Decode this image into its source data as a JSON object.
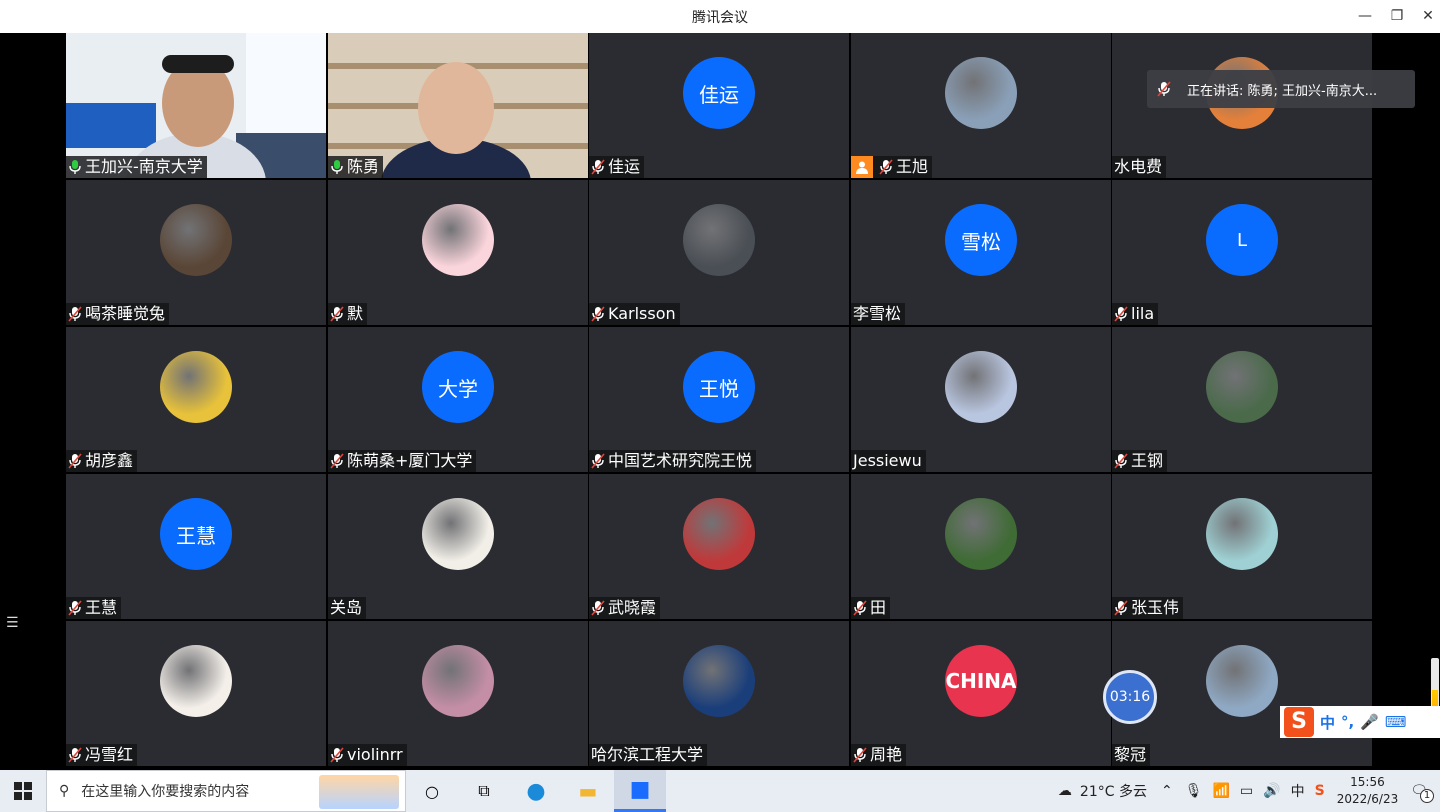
{
  "window": {
    "title": "腾讯会议"
  },
  "speaking_banner": "正在讲话: 陈勇; 王加兴-南京大...",
  "timer": "03:16",
  "participants": [
    {
      "name": "王加兴-南京大学",
      "mic": "on",
      "kind": "video",
      "scene": "office"
    },
    {
      "name": "陈勇",
      "mic": "on",
      "kind": "video",
      "scene": "shelf",
      "speaking": true
    },
    {
      "name": "佳运",
      "mic": "muted",
      "kind": "initials",
      "initials": "佳运"
    },
    {
      "name": "王旭",
      "mic": "muted",
      "kind": "photo",
      "color": "#8aa0b8",
      "host": true
    },
    {
      "name": "水电费",
      "mic": "none",
      "kind": "photo",
      "color": "#e4803a"
    },
    {
      "name": "喝茶睡觉兔",
      "mic": "muted",
      "kind": "photo",
      "color": "#5a4636"
    },
    {
      "name": "默",
      "mic": "muted",
      "kind": "photo",
      "color": "#fbd5dc"
    },
    {
      "name": "Karlsson",
      "mic": "muted",
      "kind": "photo",
      "color": "#4a4f55"
    },
    {
      "name": "李雪松",
      "mic": "none",
      "kind": "initials",
      "initials": "雪松"
    },
    {
      "name": "lila",
      "mic": "muted",
      "kind": "initials",
      "initials": "L"
    },
    {
      "name": "胡彦鑫",
      "mic": "muted",
      "kind": "photo",
      "color": "#e8c23a"
    },
    {
      "name": "陈萌桑+厦门大学",
      "mic": "muted",
      "kind": "initials",
      "initials": "大学"
    },
    {
      "name": "中国艺术研究院王悦",
      "mic": "muted",
      "kind": "initials",
      "initials": "王悦"
    },
    {
      "name": "Jessiewu",
      "mic": "none",
      "kind": "photo",
      "color": "#b9c6e0"
    },
    {
      "name": "王钢",
      "mic": "muted",
      "kind": "photo",
      "color": "#4a6a4a"
    },
    {
      "name": "王慧",
      "mic": "muted",
      "kind": "initials",
      "initials": "王慧"
    },
    {
      "name": "关岛",
      "mic": "none",
      "kind": "photo",
      "color": "#f2efe8"
    },
    {
      "name": "武晓霞",
      "mic": "muted",
      "kind": "photo",
      "color": "#c0393a"
    },
    {
      "name": "田",
      "mic": "muted",
      "kind": "photo",
      "color": "#3f6b35"
    },
    {
      "name": "张玉伟",
      "mic": "muted",
      "kind": "photo",
      "color": "#9fd1d4"
    },
    {
      "name": "冯雪红",
      "mic": "muted",
      "kind": "photo",
      "color": "#f4efe9"
    },
    {
      "name": "violinrr",
      "mic": "muted",
      "kind": "photo",
      "color": "#c48ea6"
    },
    {
      "name": "哈尔滨工程大学",
      "mic": "none",
      "kind": "photo",
      "color": "#1a3e7a"
    },
    {
      "name": "周艳",
      "mic": "muted",
      "kind": "badge",
      "badge": "CHINA"
    },
    {
      "name": "黎冠",
      "mic": "none",
      "kind": "photo",
      "color": "#8fa9c4"
    }
  ],
  "ime": {
    "logo": "S",
    "mode": "中",
    "punct": "°,"
  },
  "mic_level": 0.55,
  "taskbar": {
    "search_placeholder": "在这里输入你要搜索的内容",
    "weather": "21°C  多云",
    "ime_lang": "中",
    "time": "15:56",
    "date": "2022/6/23",
    "notification_count": "1"
  }
}
